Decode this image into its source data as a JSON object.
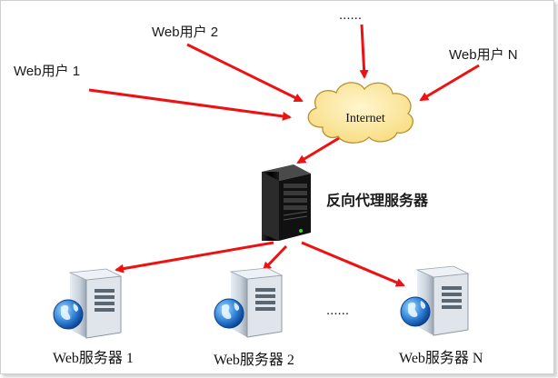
{
  "users": [
    {
      "label": "Web用户 1"
    },
    {
      "label": "Web用户 2"
    },
    {
      "label": "......"
    },
    {
      "label": "Web用户 N"
    }
  ],
  "cloud": {
    "label": "Internet"
  },
  "proxy": {
    "label": "反向代理服务器",
    "icon": "tower-server-icon"
  },
  "servers": [
    {
      "label": "Web服务器 1",
      "icon": "web-server-globe-icon"
    },
    {
      "label": "Web服务器 2",
      "icon": "web-server-globe-icon"
    },
    {
      "label": "......"
    },
    {
      "label": "Web服务器 N",
      "icon": "web-server-globe-icon"
    }
  ],
  "colors": {
    "arrow": "#ee1111",
    "cloud_fill": "#fde9a6",
    "cloud_stroke": "#b8912f"
  }
}
